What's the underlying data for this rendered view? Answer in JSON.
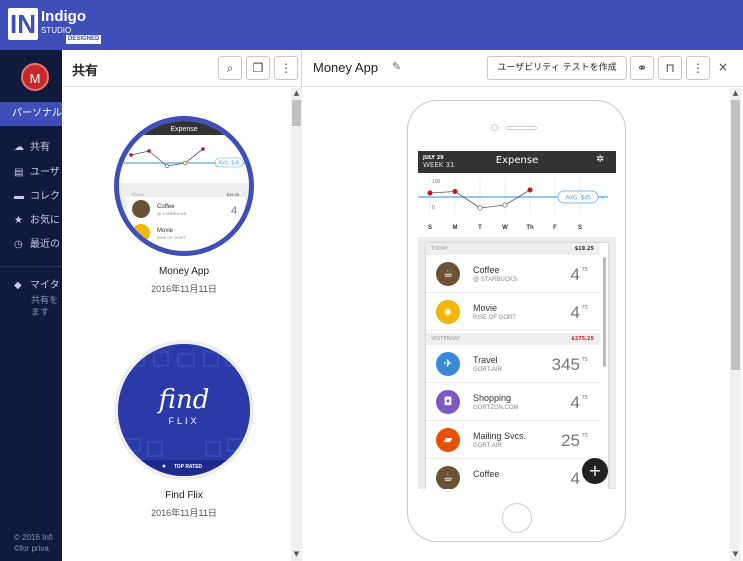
{
  "app": {
    "logo": {
      "brand": "Indigo",
      "studio": "STUDIO",
      "designed": "DESIGNED",
      "mark": "IN"
    }
  },
  "sidebar": {
    "avatar": "M",
    "section": "パーソナル",
    "items": [
      {
        "label": "共有",
        "icon": "cloud-icon"
      },
      {
        "label": "ユーザ",
        "icon": "user-icon"
      },
      {
        "label": "コレク",
        "icon": "folder-icon"
      },
      {
        "label": "お気に",
        "icon": "star-icon"
      },
      {
        "label": "最近の",
        "icon": "clock-icon"
      }
    ],
    "tag_label": "マイタ",
    "tag_desc_1": "共有を",
    "tag_desc_2": "ます",
    "footer_1": "© 2016 Infi",
    "footer_2": "©for priva"
  },
  "left_panel": {
    "title": "共有",
    "projects": [
      {
        "name": "Money App",
        "date": "2016年11月11日"
      },
      {
        "name": "Find Flix",
        "date": "2016年11月11日",
        "thumb_line1": "find",
        "thumb_line2": "FLIX",
        "badge": "TOP RATED"
      }
    ]
  },
  "right_panel": {
    "title": "Money App",
    "usability_button": "ユーザビリティ テストを作成",
    "close": "×"
  },
  "phone_app": {
    "date_line1": "JULY 29",
    "date_line2": "WEEK 31",
    "title": "Expense",
    "avg_label": "AVG. $45",
    "days": [
      "S",
      "M",
      "T",
      "W",
      "Th",
      "F",
      "S"
    ],
    "y_ticks": [
      "100",
      "0"
    ],
    "chart_values": [
      60,
      65,
      10,
      20,
      70
    ],
    "groups": [
      {
        "label": "TODAY",
        "total": "$19.25",
        "total_color": "#333333"
      },
      {
        "label": "YESTERDAY",
        "total": "$375.25",
        "total_color": "#c62828"
      }
    ],
    "rows": [
      {
        "name": "Coffee",
        "sub": "@ STARBUCKS",
        "value": "4",
        "cents": "75",
        "color": "#6d5236",
        "icon": "coffee-icon"
      },
      {
        "name": "Movie",
        "sub": "RISE OF GORT",
        "value": "4",
        "cents": "75",
        "color": "#f2b705",
        "icon": "ticket-icon"
      },
      {
        "name": "Travel",
        "sub": "GORT-AIR",
        "value": "345",
        "cents": "75",
        "color": "#3a8ad8",
        "icon": "plane-icon"
      },
      {
        "name": "Shopping",
        "sub": "GORTZON.COM",
        "value": "4",
        "cents": "75",
        "color": "#7e57c2",
        "icon": "bag-icon"
      },
      {
        "name": "Mailing Svcs.",
        "sub": "GORT-AIR",
        "value": "25",
        "cents": "75",
        "color": "#e65100",
        "icon": "truck-icon"
      },
      {
        "name": "Coffee",
        "sub": "",
        "value": "4",
        "cents": "75",
        "color": "#6d5236",
        "icon": "coffee-icon"
      }
    ],
    "fab": "+"
  },
  "colors": {
    "topbar": "#3f4fba",
    "sidebar": "#101a3c",
    "accent_line": "#5aa8e0"
  }
}
